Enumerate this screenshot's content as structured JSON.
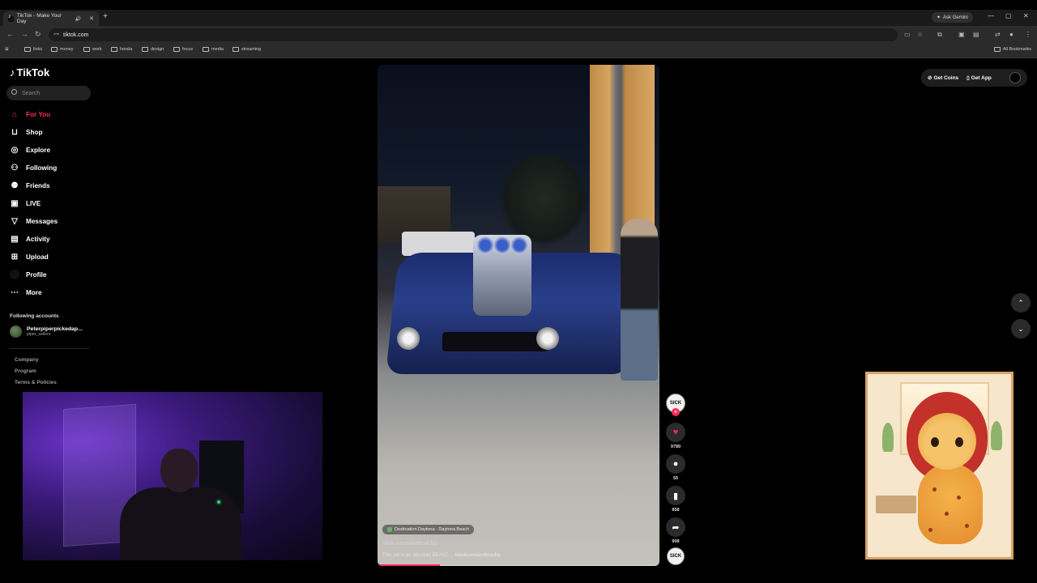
{
  "browser": {
    "tab_title": "TikTok - Make Your Day",
    "new_tab_symbol": "+",
    "ask_gemini": "Ask Gemini",
    "url": "tiktok.com",
    "bookmarks": [
      "links",
      "money",
      "work",
      "honda",
      "design",
      "focus",
      "media",
      "streaming"
    ],
    "all_bookmarks": "All Bookmarks"
  },
  "tiktok": {
    "logo": "TikTok",
    "search_placeholder": "Search",
    "nav": [
      {
        "label": "For You",
        "icon": "home-icon"
      },
      {
        "label": "Shop",
        "icon": "shop-icon"
      },
      {
        "label": "Explore",
        "icon": "compass-icon"
      },
      {
        "label": "Following",
        "icon": "following-icon"
      },
      {
        "label": "Friends",
        "icon": "friends-icon"
      },
      {
        "label": "LIVE",
        "icon": "live-icon"
      },
      {
        "label": "Messages",
        "icon": "messages-icon"
      },
      {
        "label": "Activity",
        "icon": "activity-icon"
      },
      {
        "label": "Upload",
        "icon": "upload-icon"
      },
      {
        "label": "Profile",
        "icon": "profile-icon"
      },
      {
        "label": "More",
        "icon": "more-icon"
      }
    ],
    "following_title": "Following accounts",
    "following_account": {
      "name": "Peterpiperpickedap...",
      "handle": "piper_sellers"
    },
    "footer_links": [
      "Company",
      "Program",
      "Terms & Policies"
    ],
    "get_coins": "Get Coins",
    "get_app": "Get App",
    "video": {
      "location": "Destination Daytona - Daytona Beach",
      "author": "sick.carsandtrucks",
      "caption": "This car is an absolute BEAST",
      "hashtag": "#sickcarsandtrucks",
      "progress": 0.22
    },
    "creator_badge": "SICK",
    "follow_plus": "+",
    "actions": {
      "likes": "9789",
      "comments": "55",
      "saves": "858",
      "shares": "908"
    }
  },
  "colors": {
    "accent": "#fe2c55",
    "chrome_bg": "#2b2b2b",
    "page_bg": "#000000"
  }
}
